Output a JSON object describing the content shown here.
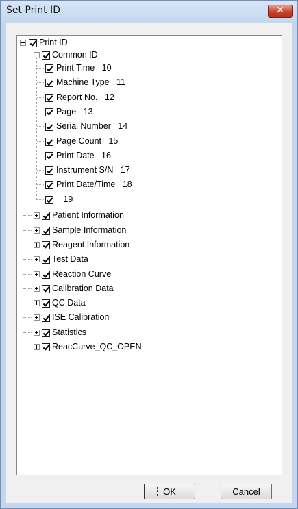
{
  "window": {
    "title": "Set Print ID",
    "close_label": "✕"
  },
  "tree": {
    "root": "Print ID",
    "common": "Common ID",
    "common_items": [
      "Print Time   10",
      "Machine Type   11",
      "Report No.   12",
      "Page   13",
      "Serial Number   14",
      "Page Count   15",
      "Print Date   16",
      "Instrument S/N   17",
      "Print Date/Time   18",
      "   19"
    ],
    "groups": [
      "Patient Information",
      "Sample Information",
      "Reagent Information",
      "Test Data",
      "Reaction Curve",
      "Calibration Data",
      "QC Data",
      "ISE Calibration",
      "Statistics",
      "ReacCurve_QC_OPEN"
    ]
  },
  "buttons": {
    "ok": "OK",
    "cancel": "Cancel"
  }
}
